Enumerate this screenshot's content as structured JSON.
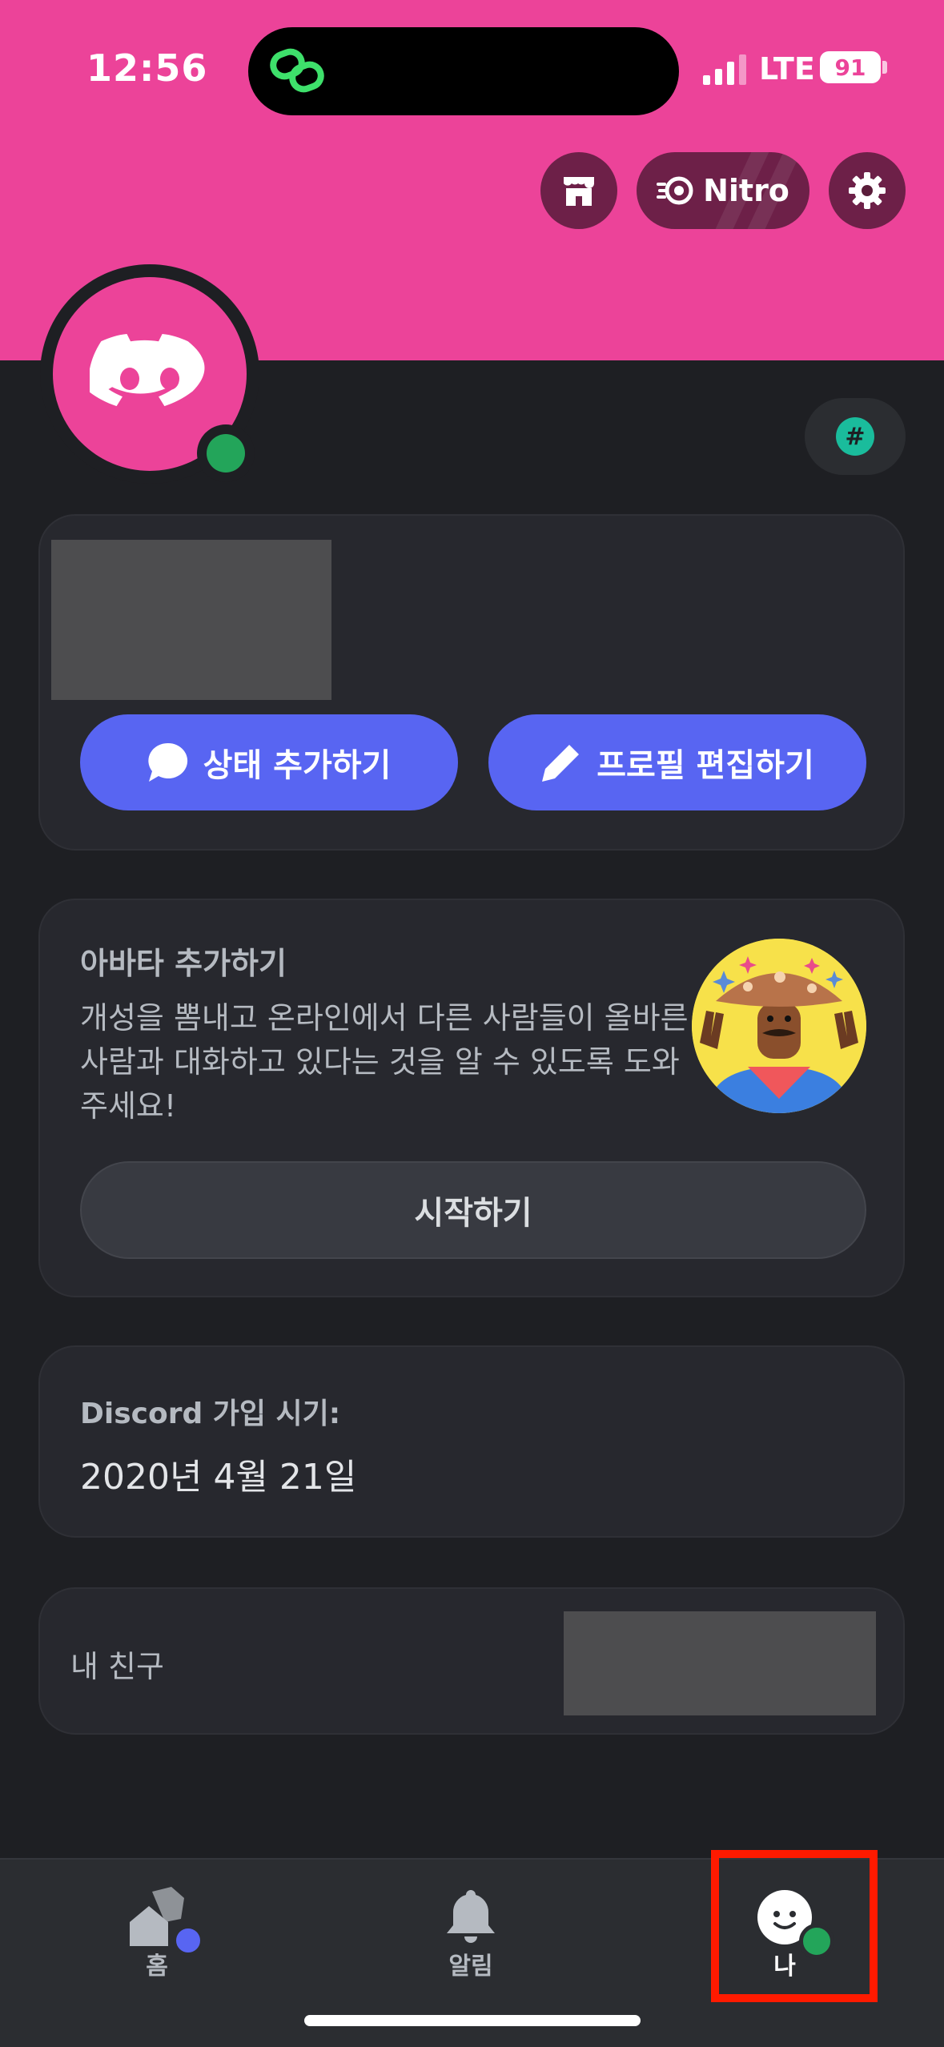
{
  "status_bar": {
    "time": "12:56",
    "network": "LTE",
    "battery": "91"
  },
  "header": {
    "nitro_label": "Nitro"
  },
  "profile": {
    "add_status_label": "상태 추가하기",
    "edit_profile_label": "프로필 편집하기"
  },
  "avatar_card": {
    "title": "아바타 추가하기",
    "description": "개성을 뽐내고 온라인에서 다른 사람들이 올바른 사람과 대화하고 있다는 것을 알 수 있도록 도와주세요!",
    "start_label": "시작하기"
  },
  "joined_card": {
    "label": "Discord 가입 시기:",
    "date": "2020년 4월 21일"
  },
  "friends_card": {
    "label": "내 친구"
  },
  "bottom_nav": {
    "items": [
      {
        "label": "홈",
        "icon": "home-icon"
      },
      {
        "label": "알림",
        "icon": "bell-icon"
      },
      {
        "label": "나",
        "icon": "me-avatar-icon"
      }
    ]
  },
  "colors": {
    "banner": "#ec4399",
    "accent": "#5865f2",
    "online": "#23a55a",
    "highlight": "#ff1a00"
  }
}
